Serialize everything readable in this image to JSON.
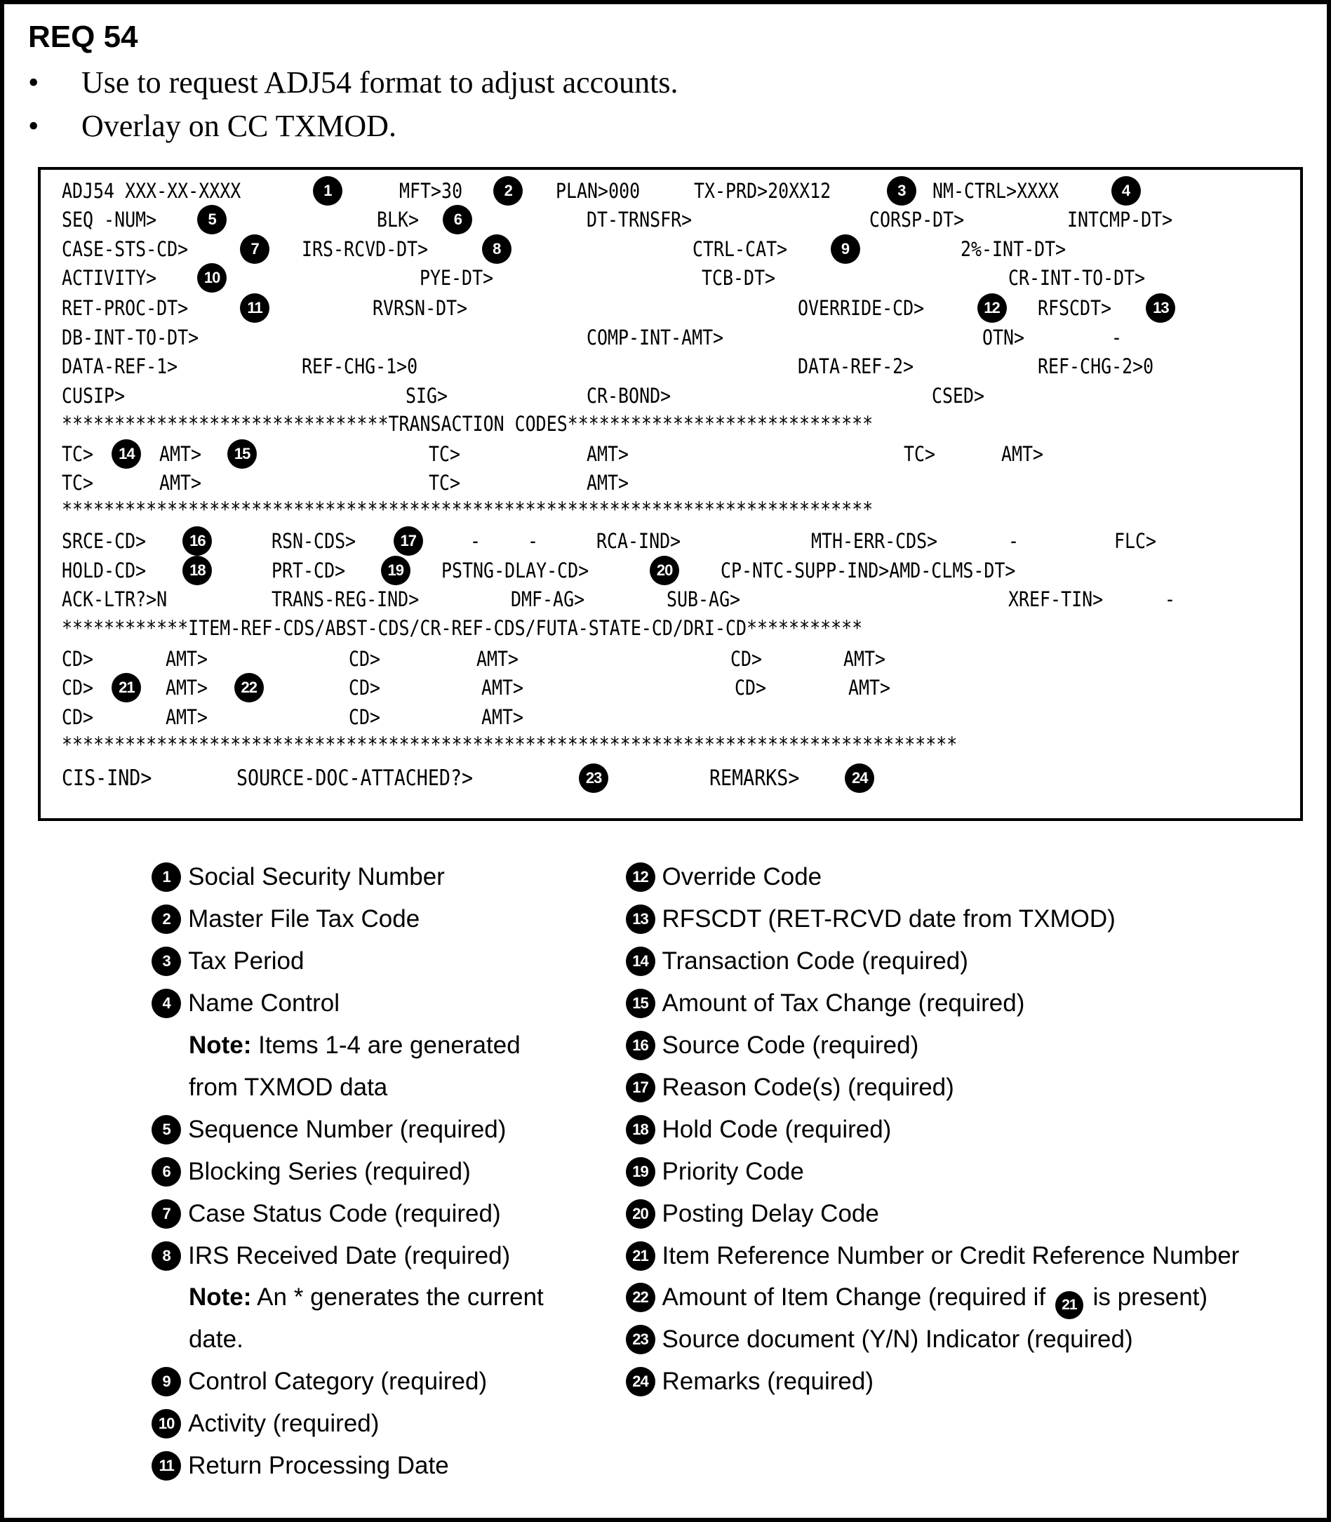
{
  "header": {
    "title": "REQ 54",
    "bullets": [
      "Use to request ADJ54 format to adjust accounts.",
      "Overlay on CC TXMOD."
    ]
  },
  "screen": {
    "rows": [
      [
        {
          "text": "ADJ54 XXX-XX-XXXX",
          "col": 0,
          "callout": "1"
        },
        {
          "text": "MFT>30",
          "col": 1,
          "callout": "2"
        },
        {
          "text": "PLAN>000",
          "col": 2
        },
        {
          "text": "TX-PRD>20XX12",
          "col": 3,
          "callout": "3"
        },
        {
          "text": "NM-CTRL>XXXX",
          "col": 4,
          "callout": "4"
        }
      ],
      [
        {
          "text": "SEQ -NUM>",
          "callout": "5"
        },
        {
          "text": "BLK>",
          "callout": "6"
        },
        {
          "text": "DT-TRNSFR>"
        },
        {
          "text": "CORSP-DT>"
        },
        {
          "text": "INTCMP-DT>"
        }
      ],
      [
        {
          "text": "CASE-STS-CD>",
          "callout": "7"
        },
        {
          "text": "IRS-RCVD-DT>",
          "callout": "8"
        },
        {
          "text": "CTRL-CAT>",
          "callout": "9"
        },
        {
          "text": "2%-INT-DT>"
        }
      ],
      [
        {
          "text": "ACTIVITY>",
          "callout": "10"
        },
        {
          "text": "PYE-DT>"
        },
        {
          "text": "TCB-DT>"
        },
        {
          "text": "CR-INT-TO-DT>"
        }
      ],
      [
        {
          "text": "RET-PROC-DT>",
          "callout": "11"
        },
        {
          "text": "RVRSN-DT>"
        },
        {
          "text": "OVERRIDE-CD>",
          "callout": "12"
        },
        {
          "text": "RFSCDT>",
          "callout": "13"
        }
      ],
      [
        {
          "text": "DB-INT-TO-DT>"
        },
        {
          "text": "COMP-INT-AMT>"
        },
        {
          "text": "OTN>"
        },
        {
          "text": "-"
        }
      ],
      [
        {
          "text": "DATA-REF-1>"
        },
        {
          "text": "REF-CHG-1>0"
        },
        {
          "text": "DATA-REF-2>"
        },
        {
          "text": "REF-CHG-2>0"
        }
      ],
      [
        {
          "text": "CUSIP>"
        },
        {
          "text": "SIG>"
        },
        {
          "text": "CR-BOND>"
        },
        {
          "text": "CSED>"
        }
      ],
      [
        {
          "text": "*******************************TRANSACTION CODES*****************************"
        }
      ],
      [
        {
          "text": "TC>",
          "callout": "14"
        },
        {
          "text": "AMT>",
          "callout": "15"
        },
        {
          "text": "TC>"
        },
        {
          "text": "AMT>"
        },
        {
          "text": "TC>"
        },
        {
          "text": "AMT>"
        }
      ],
      [
        {
          "text": "TC>"
        },
        {
          "text": "AMT>"
        },
        {
          "text": "TC>"
        },
        {
          "text": "AMT>"
        }
      ],
      [
        {
          "text": "*****************************************************************************"
        }
      ],
      [
        {
          "text": "SRCE-CD>",
          "callout": "16"
        },
        {
          "text": "RSN-CDS>",
          "callout": "17"
        },
        {
          "text": "-"
        },
        {
          "text": "-"
        },
        {
          "text": "RCA-IND>"
        },
        {
          "text": "MTH-ERR-CDS>"
        },
        {
          "text": "-"
        },
        {
          "text": "FLC>"
        }
      ],
      [
        {
          "text": "HOLD-CD>",
          "callout": "18"
        },
        {
          "text": "PRT-CD>",
          "callout": "19"
        },
        {
          "text": "PSTNG-DLAY-CD>",
          "callout": "20"
        },
        {
          "text": "CP-NTC-SUPP-IND>AMD-CLMS-DT>"
        }
      ],
      [
        {
          "text": "ACK-LTR?>N"
        },
        {
          "text": "TRANS-REG-IND>"
        },
        {
          "text": "DMF-AG>"
        },
        {
          "text": "SUB-AG>"
        },
        {
          "text": "XREF-TIN>"
        },
        {
          "text": "-"
        }
      ],
      [
        {
          "text": "************ITEM-REF-CDS/ABST-CDS/CR-REF-CDS/FUTA-STATE-CD/DRI-CD***********"
        }
      ],
      [
        {
          "text": "CD>"
        },
        {
          "text": "AMT>"
        },
        {
          "text": "CD>"
        },
        {
          "text": "AMT>"
        },
        {
          "text": "CD>"
        },
        {
          "text": "AMT>"
        }
      ],
      [
        {
          "text": "CD>",
          "callout": "21"
        },
        {
          "text": "AMT>",
          "callout": "22"
        },
        {
          "text": "CD>"
        },
        {
          "text": "AMT>"
        },
        {
          "text": "CD>"
        },
        {
          "text": "AMT>"
        }
      ],
      [
        {
          "text": "CD>"
        },
        {
          "text": "AMT>"
        },
        {
          "text": "CD>"
        },
        {
          "text": "AMT>"
        }
      ],
      [
        {
          "text": "*************************************************************************************"
        }
      ],
      [
        {
          "text": "CIS-IND>"
        },
        {
          "text": "SOURCE-DOC-ATTACHED?>",
          "callout": "23"
        },
        {
          "text": "REMARKS>",
          "callout": "24"
        }
      ]
    ]
  },
  "legend": {
    "left": [
      {
        "num": "1",
        "label": "Social Security Number"
      },
      {
        "num": "2",
        "label": "Master File Tax Code"
      },
      {
        "num": "3",
        "label": "Tax Period"
      },
      {
        "num": "4",
        "label": "Name Control"
      },
      {
        "note_label": "Note:",
        "note_text": " Items 1-4 are generated",
        "note_cont": "from TXMOD data"
      },
      {
        "num": "5",
        "label": "Sequence Number (required)"
      },
      {
        "num": "6",
        "label": "Blocking Series (required)"
      },
      {
        "num": "7",
        "label": "Case Status Code (required)"
      },
      {
        "num": "8",
        "label": "IRS Received Date (required)"
      },
      {
        "note_label": "Note:",
        "note_text": " An * generates the current",
        "note_cont": "date."
      },
      {
        "num": "9",
        "label": "Control Category (required)"
      },
      {
        "num": "10",
        "label": "Activity (required)"
      },
      {
        "num": "11",
        "label": "Return Processing Date"
      }
    ],
    "right": [
      {
        "num": "12",
        "label": "Override Code"
      },
      {
        "num": "13",
        "label": "RFSCDT (RET-RCVD date from TXMOD)"
      },
      {
        "num": "14",
        "label": "Transaction Code (required)"
      },
      {
        "num": "15",
        "label": "Amount of Tax Change (required)"
      },
      {
        "num": "16",
        "label": "Source Code (required)"
      },
      {
        "num": "17",
        "label": "Reason Code(s) (required)"
      },
      {
        "num": "18",
        "label": "Hold Code (required)"
      },
      {
        "num": "19",
        "label": "Priority Code"
      },
      {
        "num": "20",
        "label": "Posting Delay Code"
      },
      {
        "num": "21",
        "label": "Item Reference Number or Credit Reference Number"
      },
      {
        "num": "22",
        "label": "Amount of Item Change (required if ",
        "inline_ref": "21",
        "label_after": " is present)"
      },
      {
        "num": "23",
        "label": "Source document (Y/N) Indicator (required)"
      },
      {
        "num": "24",
        "label": "Remarks (required)"
      }
    ]
  }
}
